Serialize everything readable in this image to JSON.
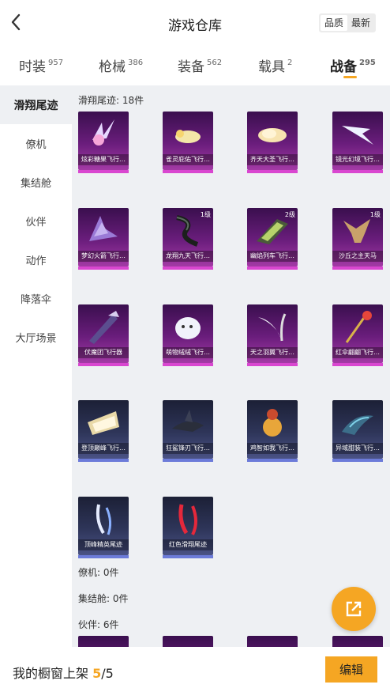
{
  "header": {
    "title": "游戏仓库",
    "sort_quality": "品质",
    "sort_latest": "最新"
  },
  "tabs": [
    {
      "label": "时装",
      "count": "957"
    },
    {
      "label": "枪械",
      "count": "386"
    },
    {
      "label": "装备",
      "count": "562"
    },
    {
      "label": "载具",
      "count": "2"
    },
    {
      "label": "战备",
      "count": "295"
    }
  ],
  "sidebar": [
    "滑翔尾迹",
    "僚机",
    "集结舱",
    "伙伴",
    "动作",
    "降落伞",
    "大厅场景"
  ],
  "sections": {
    "glide": "滑翔尾迹: 18件",
    "wingman": "僚机: 0件",
    "pod": "集结舱: 0件",
    "partner": "伙伴: 6件"
  },
  "items": [
    {
      "name": "炫彩糖果飞行…",
      "level": "",
      "color": "purple"
    },
    {
      "name": "雀灵庇佑飞行…",
      "level": "",
      "color": "purple"
    },
    {
      "name": "齐天大圣飞行…",
      "level": "",
      "color": "purple"
    },
    {
      "name": "镜光幻境飞行…",
      "level": "",
      "color": "purple"
    },
    {
      "name": "梦幻火箭飞行…",
      "level": "",
      "color": "purple"
    },
    {
      "name": "龙翔九天飞行…",
      "level": "1级",
      "color": "purple"
    },
    {
      "name": "幽焰列车飞行…",
      "level": "2级",
      "color": "purple"
    },
    {
      "name": "沙丘之主天马",
      "level": "1级",
      "color": "purple"
    },
    {
      "name": "伏魔团飞行器",
      "level": "",
      "color": "purple"
    },
    {
      "name": "萌物绒绒飞行…",
      "level": "",
      "color": "purple"
    },
    {
      "name": "天之羽翼飞行…",
      "level": "",
      "color": "purple"
    },
    {
      "name": "红伞翩翩飞行…",
      "level": "",
      "color": "purple"
    },
    {
      "name": "登顶巅峰飞行…",
      "level": "",
      "color": "blue"
    },
    {
      "name": "狂鲨锋刃飞行…",
      "level": "",
      "color": "blue"
    },
    {
      "name": "鸡智如我飞行…",
      "level": "",
      "color": "blue"
    },
    {
      "name": "异域甜装飞行…",
      "level": "",
      "color": "blue"
    },
    {
      "name": "顶峰精英尾迹",
      "level": "",
      "color": "blue"
    },
    {
      "name": "红色滑翔尾迹",
      "level": "",
      "color": "blue"
    }
  ],
  "bottom": {
    "label": "我的橱窗上架",
    "current": "5",
    "total": "/5",
    "edit": "编辑"
  },
  "colors": {
    "accent": "#f5a623",
    "purple_bar": "#d947d0",
    "blue_bar": "#6c7bd9"
  }
}
